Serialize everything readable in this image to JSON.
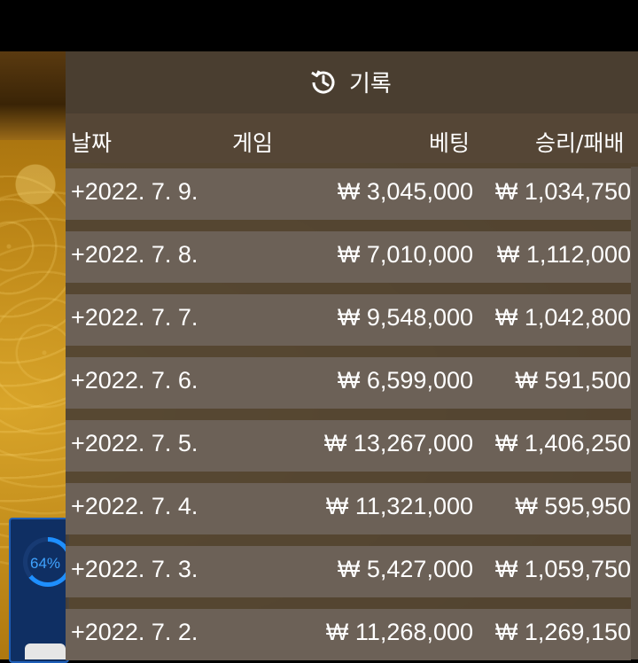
{
  "panel": {
    "title": "기록",
    "columns": {
      "date": "날짜",
      "game": "게임",
      "bet": "베팅",
      "result": "승리/패배"
    },
    "rows": [
      {
        "date": "+2022. 7. 9.",
        "bet": "₩ 3,045,000",
        "result": "₩ 1,034,750"
      },
      {
        "date": "+2022. 7. 8.",
        "bet": "₩ 7,010,000",
        "result": "₩ 1,112,000"
      },
      {
        "date": "+2022. 7. 7.",
        "bet": "₩ 9,548,000",
        "result": "₩ 1,042,800"
      },
      {
        "date": "+2022. 7. 6.",
        "bet": "₩ 6,599,000",
        "result": "₩ 591,500"
      },
      {
        "date": "+2022. 7. 5.",
        "bet": "₩ 13,267,000",
        "result": "₩ 1,406,250"
      },
      {
        "date": "+2022. 7. 4.",
        "bet": "₩ 11,321,000",
        "result": "₩ 595,950"
      },
      {
        "date": "+2022. 7. 3.",
        "bet": "₩ 5,427,000",
        "result": "₩ 1,059,750"
      },
      {
        "date": "+2022. 7. 2.",
        "bet": "₩ 11,268,000",
        "result": "₩ 1,269,150"
      }
    ]
  },
  "widget": {
    "progress_label": "64%",
    "progress_fraction": 0.64
  },
  "colors": {
    "panel_bg": "#4e4234",
    "row_bg": "#6c6157",
    "accent_blue": "#1e8fff"
  },
  "icons": {
    "history": "history-icon"
  }
}
